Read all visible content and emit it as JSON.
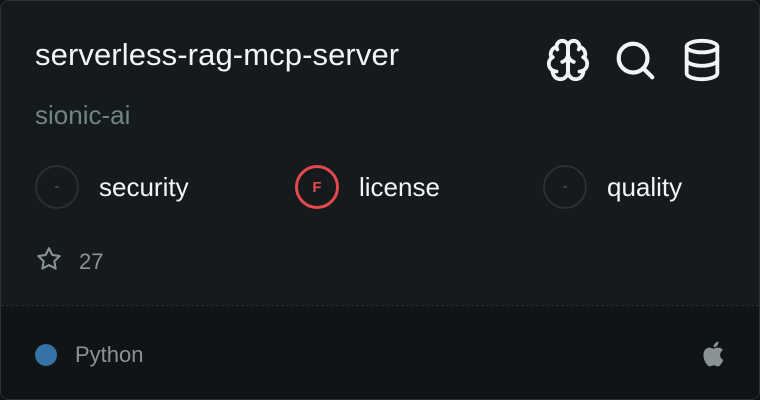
{
  "repo": {
    "name": "serverless-rag-mcp-server",
    "owner": "sionic-ai",
    "stars": "27"
  },
  "header_icons": [
    "brain-icon",
    "search-icon",
    "database-icon"
  ],
  "scores": [
    {
      "grade": "-",
      "label": "security"
    },
    {
      "grade": "F",
      "label": "license"
    },
    {
      "grade": "-",
      "label": "quality"
    }
  ],
  "footer": {
    "language": "Python",
    "language_color": "#3572a5",
    "platform_icon": "apple-icon"
  },
  "colors": {
    "grade_fail": "#e5484d",
    "owner_text": "#6f857e"
  }
}
